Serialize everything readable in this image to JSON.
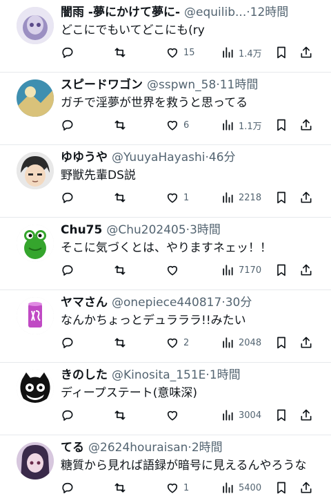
{
  "tweets": [
    {
      "name": "闇雨 -夢にかけて夢に-",
      "handle": "@equilib...",
      "time": "12時間",
      "text": "どこにでもいてどこにも(ry",
      "likes": "15",
      "views": "1.4万",
      "avatar_colors": [
        "#9b8fc2",
        "#e9e6f3"
      ]
    },
    {
      "name": "スピードワゴン",
      "handle": "@sspwn_58",
      "time": "11時間",
      "text": "ガチで淫夢が世界を救うと思ってる",
      "likes": "6",
      "views": "1.1万",
      "avatar_colors": [
        "#3f8fb0",
        "#d9c27a"
      ]
    },
    {
      "name": "ゆゆうや",
      "handle": "@YuuyaHayashi",
      "time": "46分",
      "text": "野獣先輩DS説",
      "likes": "1",
      "views": "2218",
      "avatar_colors": [
        "#2b2b2b",
        "#f3d9c0"
      ]
    },
    {
      "name": "Chu75",
      "handle": "@Chu202405",
      "time": "3時間",
      "text": "そこに気づくとは、やりますネェッ！！",
      "likes": "",
      "views": "7170",
      "avatar_colors": [
        "#35a52d",
        "#ffffff"
      ]
    },
    {
      "name": "ヤマさん",
      "handle": "@onepiece440817",
      "time": "30分",
      "text": "なんかちょっとデュラララ!!みたい",
      "likes": "2",
      "views": "2048",
      "avatar_colors": [
        "#c04ac4",
        "#ffffff"
      ]
    },
    {
      "name": "きのした",
      "handle": "@Kinosita_151E",
      "time": "1時間",
      "text": "ディープステート(意味深)",
      "likes": "",
      "views": "3004",
      "avatar_colors": [
        "#111111",
        "#ffffff"
      ]
    },
    {
      "name": "てる",
      "handle": "@2624houraisan",
      "time": "2時間",
      "text": "糖質から見れば語録が暗号に見えるんやろうな",
      "likes": "1",
      "views": "5400",
      "avatar_colors": [
        "#3a2a4a",
        "#f0d8e4"
      ]
    }
  ],
  "separator": "·",
  "icons": {
    "reply": "reply-icon",
    "retweet": "retweet-icon",
    "like": "like-icon",
    "views": "views-icon",
    "bookmark": "bookmark-icon",
    "share": "share-icon"
  },
  "colors": {
    "text": "#0f1419",
    "secondary": "#536471",
    "divider": "#e6e9ec"
  }
}
